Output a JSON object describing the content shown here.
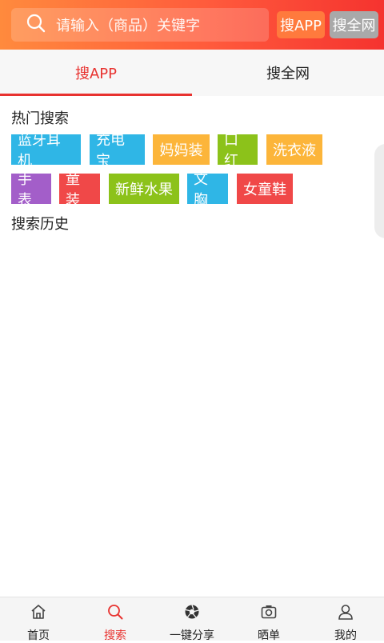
{
  "header": {
    "search_placeholder": "请输入（商品）关键字",
    "btn_search_app": "搜APP",
    "btn_search_web": "搜全网"
  },
  "tabs": [
    {
      "label": "搜APP",
      "active": true
    },
    {
      "label": "搜全网",
      "active": false
    }
  ],
  "hot": {
    "title": "热门搜索",
    "tags": [
      {
        "label": "蓝牙耳机",
        "color": "#2fb6e6"
      },
      {
        "label": "充电宝",
        "color": "#2fb6e6"
      },
      {
        "label": "妈妈装",
        "color": "#fcb53a"
      },
      {
        "label": "口红",
        "color": "#8cc21a"
      },
      {
        "label": "洗衣液",
        "color": "#fcb53a"
      },
      {
        "label": "手表",
        "color": "#a35ec9"
      },
      {
        "label": "童装",
        "color": "#f04848"
      },
      {
        "label": "新鲜水果",
        "color": "#8cc21a"
      },
      {
        "label": "文胸",
        "color": "#2fb6e6"
      },
      {
        "label": "女童鞋",
        "color": "#f04848"
      }
    ]
  },
  "history": {
    "title": "搜索历史"
  },
  "bottom_nav": [
    {
      "label": "首页",
      "icon": "home-icon"
    },
    {
      "label": "搜索",
      "icon": "search-icon",
      "active": true
    },
    {
      "label": "一键分享",
      "icon": "aperture-icon"
    },
    {
      "label": "晒单",
      "icon": "camera-icon"
    },
    {
      "label": "我的",
      "icon": "user-icon"
    }
  ],
  "colors": {
    "accent": "#e8322f",
    "header_gradient_start": "#ff8a3d",
    "header_gradient_end": "#f5332f"
  }
}
